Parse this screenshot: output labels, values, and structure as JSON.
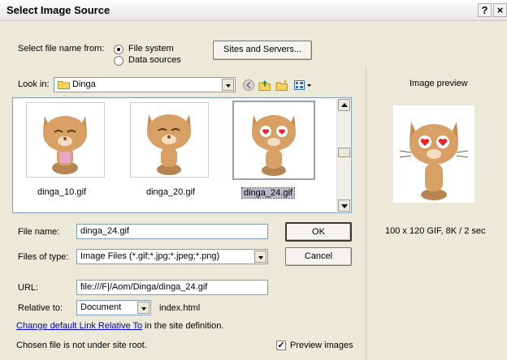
{
  "window": {
    "title": "Select Image Source",
    "help_label": "?",
    "close_label": "×"
  },
  "source": {
    "label": "Select file name from:",
    "options": [
      "File system",
      "Data sources"
    ],
    "selected": "File system",
    "sites_button": "Sites and Servers..."
  },
  "lookin": {
    "label": "Look in:",
    "value": "Dinga"
  },
  "toolbar": {
    "icons": [
      "back-icon",
      "up-folder-icon",
      "new-folder-icon",
      "view-menu-icon"
    ]
  },
  "files": [
    {
      "name": "dinga_10.gif",
      "selected": false
    },
    {
      "name": "dinga_20.gif",
      "selected": false
    },
    {
      "name": "dinga_24.gif",
      "selected": true
    }
  ],
  "form": {
    "filename_label": "File name:",
    "filename_value": "dinga_24.gif",
    "filetype_label": "Files of type:",
    "filetype_value": "Image Files (*.gif;*.jpg;*.jpeg;*.png)",
    "ok_label": "OK",
    "cancel_label": "Cancel",
    "url_label": "URL:",
    "url_value": "file:///F|/Aom/Dinga/dinga_24.gif",
    "relative_label": "Relative to:",
    "relative_value": "Document",
    "relative_file": "index.html",
    "link_text": "Change default Link Relative To",
    "link_suffix": " in the site definition.",
    "status": "Chosen file is not under site root.",
    "preview_label": "Preview images",
    "preview_checked": true
  },
  "preview": {
    "title": "Image preview",
    "info": "100 x 120 GIF, 8K / 2 sec"
  },
  "colors": {
    "dialog_bg": "#ece9d8",
    "link": "#0000cc",
    "field_border": "#7f9db9"
  }
}
